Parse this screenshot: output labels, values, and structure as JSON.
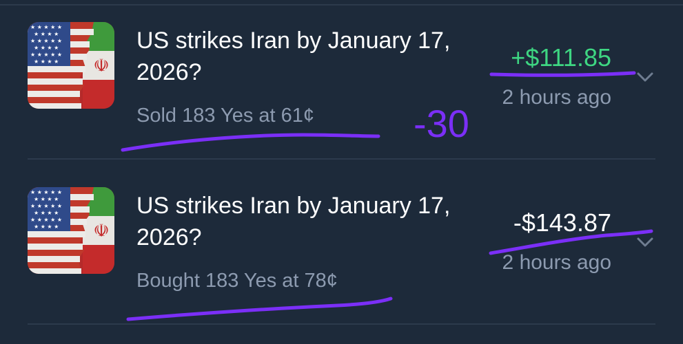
{
  "trades": [
    {
      "icon": "us-iran-flag-icon",
      "title": "US strikes Iran by January 17, 2026?",
      "detail": "Sold 183 Yes at 61¢",
      "amount": "+$111.85",
      "amount_color": "#3ed682",
      "time": "2 hours ago"
    },
    {
      "icon": "us-iran-flag-icon",
      "title": "US strikes Iran by January 17, 2026?",
      "detail": "Bought 183 Yes at 78¢",
      "amount": "-$143.87",
      "amount_color": "#ffffff",
      "time": "2 hours ago"
    }
  ],
  "annotation": {
    "note": "-30",
    "ink_color": "#7b2ff7"
  }
}
